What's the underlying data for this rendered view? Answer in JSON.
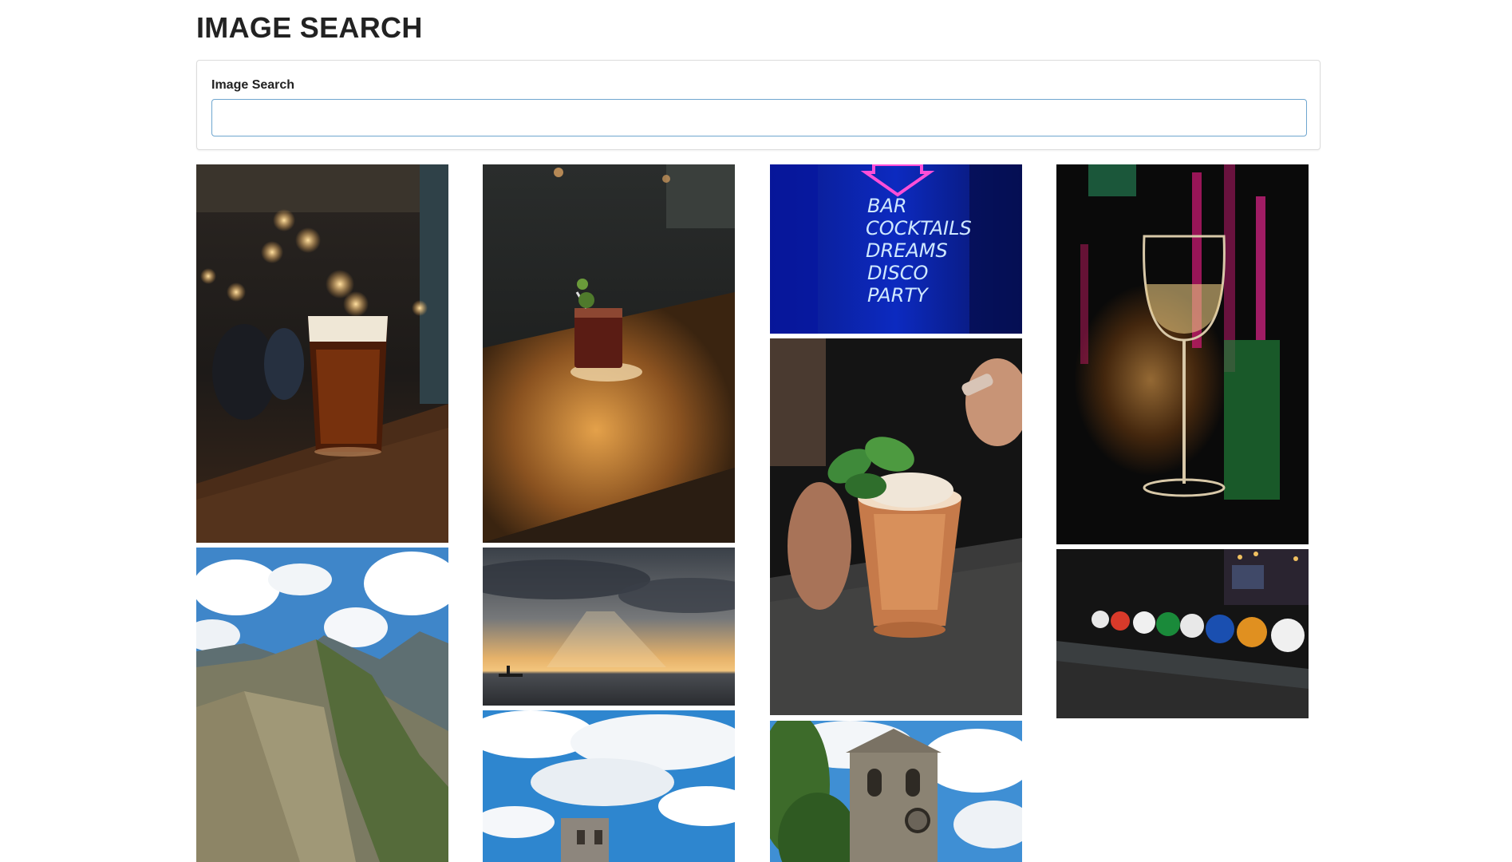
{
  "page": {
    "title": "IMAGE SEARCH"
  },
  "search": {
    "label": "Image Search",
    "value": "",
    "placeholder": ""
  },
  "gallery": {
    "images": [
      {
        "name": "beer-glass-on-bar-photo"
      },
      {
        "name": "cocktail-on-wooden-table-photo"
      },
      {
        "name": "neon-bar-sign-photo"
      },
      {
        "name": "wine-glass-neon-lights-photo"
      },
      {
        "name": "mint-julep-cocktail-photo"
      },
      {
        "name": "mountain-landscape-photo"
      },
      {
        "name": "sunset-over-sea-photo"
      },
      {
        "name": "beer-taps-row-photo"
      },
      {
        "name": "clock-tower-blue-sky-photo"
      },
      {
        "name": "stone-clock-tower-photo"
      }
    ],
    "neon_sign_lines": [
      "BAR",
      "COCKTAILS",
      "DREAMS",
      "DISCO",
      "PARTY"
    ]
  }
}
